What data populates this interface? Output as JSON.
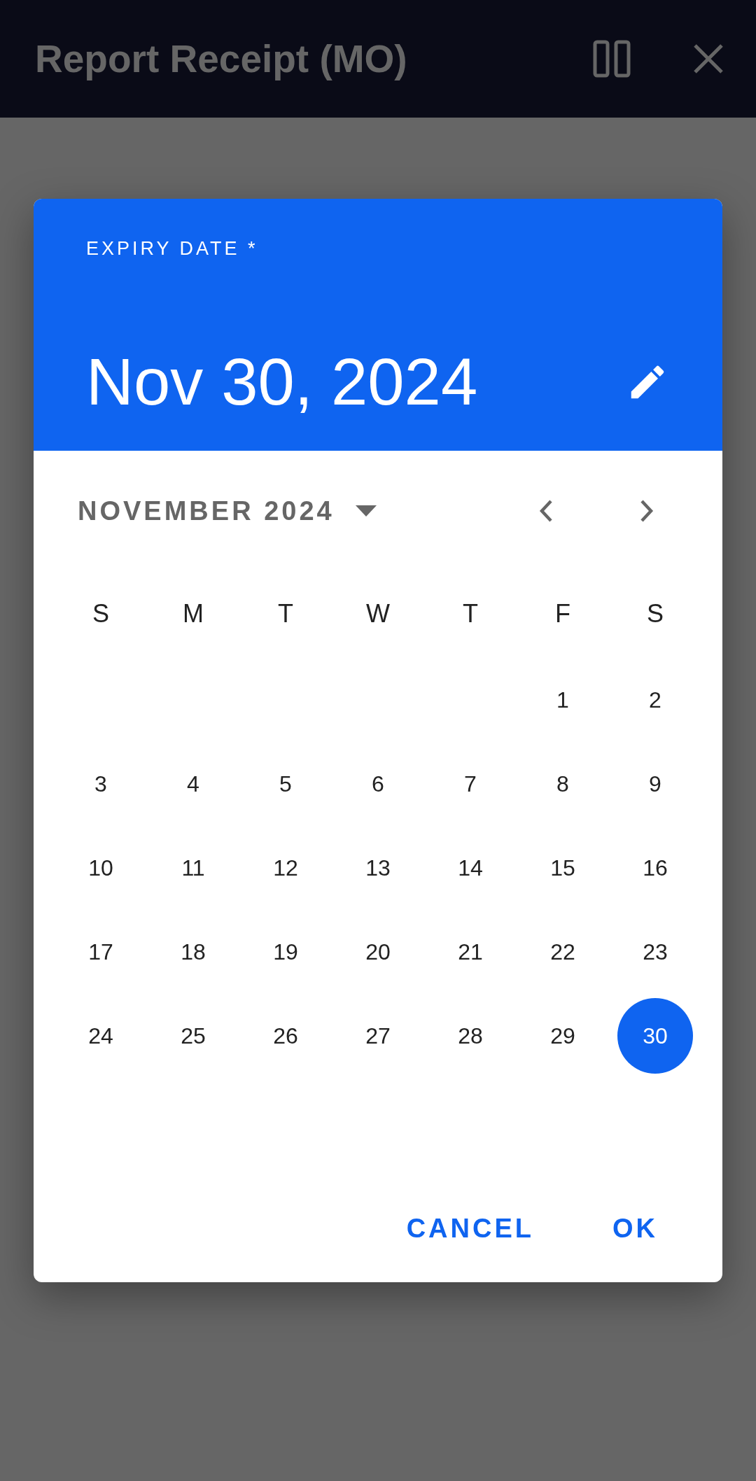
{
  "app_bar": {
    "title": "Report Receipt (MO)"
  },
  "date_picker": {
    "label": "EXPIRY DATE *",
    "date": "Nov 30, 2024",
    "month": "NOVEMBER 2024",
    "weekdays": [
      "S",
      "M",
      "T",
      "W",
      "T",
      "F",
      "S"
    ],
    "weeks": [
      [
        {
          "label": "1",
          "selected": false
        },
        {
          "label": "2",
          "selected": false
        }
      ],
      [
        {
          "label": "3",
          "selected": false
        },
        {
          "label": "4",
          "selected": false
        },
        {
          "label": "5",
          "selected": false
        },
        {
          "label": "6",
          "selected": false
        },
        {
          "label": "7",
          "selected": false
        },
        {
          "label": "8",
          "selected": false
        },
        {
          "label": "9",
          "selected": false
        }
      ],
      [
        {
          "label": "10",
          "selected": false
        },
        {
          "label": "11",
          "selected": false
        },
        {
          "label": "12",
          "selected": false
        },
        {
          "label": "13",
          "selected": false
        },
        {
          "label": "14",
          "selected": false
        },
        {
          "label": "15",
          "selected": false
        },
        {
          "label": "16",
          "selected": false
        }
      ],
      [
        {
          "label": "17",
          "selected": false
        },
        {
          "label": "18",
          "selected": false
        },
        {
          "label": "19",
          "selected": false
        },
        {
          "label": "20",
          "selected": false
        },
        {
          "label": "21",
          "selected": false
        },
        {
          "label": "22",
          "selected": false
        },
        {
          "label": "23",
          "selected": false
        }
      ],
      [
        {
          "label": "24",
          "selected": false
        },
        {
          "label": "25",
          "selected": false
        },
        {
          "label": "26",
          "selected": false
        },
        {
          "label": "27",
          "selected": false
        },
        {
          "label": "28",
          "selected": false
        },
        {
          "label": "29",
          "selected": false
        },
        {
          "label": "30",
          "selected": true
        }
      ]
    ],
    "buttons": [
      "CANCEL",
      "OK"
    ]
  }
}
